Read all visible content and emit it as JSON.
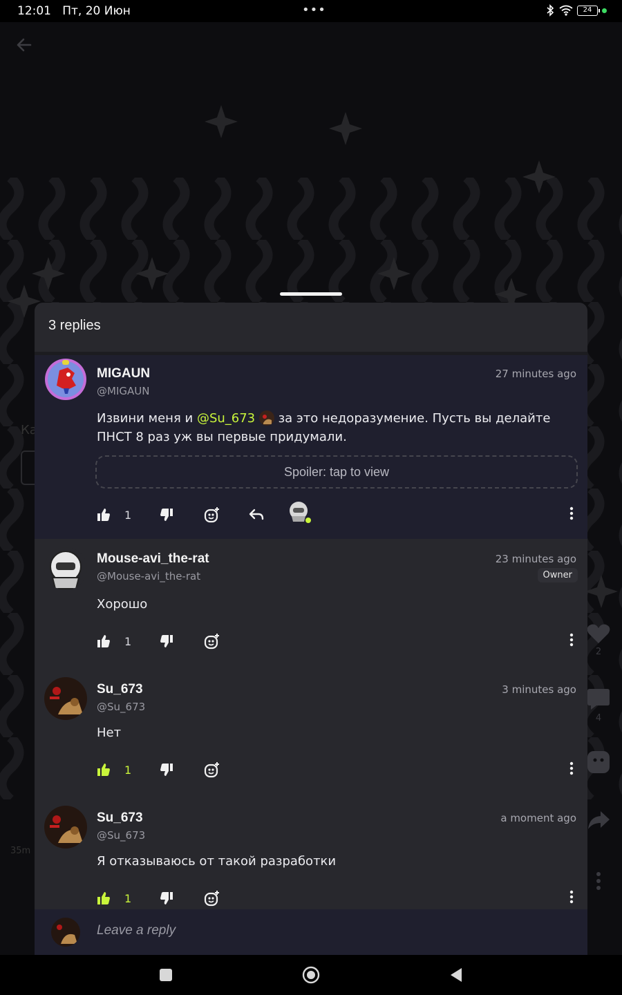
{
  "status_bar": {
    "time": "12:01",
    "date": "Пт, 20 Июн",
    "more": "•••",
    "battery": "24",
    "icons": [
      "bluetooth-icon",
      "wifi-icon",
      "battery-icon",
      "status-dot"
    ]
  },
  "background": {
    "left_text": "Ка",
    "left_time": "35m",
    "side_actions": [
      {
        "icon": "heart-icon",
        "count": "2"
      },
      {
        "icon": "comment-icon",
        "count": "4"
      },
      {
        "icon": "sticker-icon",
        "count": ""
      },
      {
        "icon": "share-icon",
        "count": ""
      },
      {
        "icon": "more-icon",
        "count": ""
      }
    ]
  },
  "sheet": {
    "title": "3 replies"
  },
  "comments": [
    {
      "name": "MIGAUN",
      "handle": "@MIGAUN",
      "time": "27 minutes ago",
      "text_before": "Извини меня и ",
      "mention": "@Su_673",
      "text_after": " за это недоразумение. Пусть вы делайте ПНСТ 8 раз уж вы первые придумали.",
      "spoiler": "Spoiler: tap to view",
      "likes": "1",
      "liked": false
    },
    {
      "name": "Mouse-avi_the-rat",
      "handle": "@Mouse-avi_the-rat",
      "time": "23 minutes ago",
      "badge": "Owner",
      "text": "Хорошо",
      "likes": "1",
      "liked": false
    },
    {
      "name": "Su_673",
      "handle": "@Su_673",
      "time": "3 minutes ago",
      "text": "Нет",
      "likes": "1",
      "liked": true
    },
    {
      "name": "Su_673",
      "handle": "@Su_673",
      "time": "a moment ago",
      "text": "Я отказываюсь от такой разработки",
      "likes": "1",
      "liked": true
    }
  ],
  "reply_bar": {
    "placeholder": "Leave a reply"
  },
  "colors": {
    "accent": "#c9f53b",
    "sheet_bg": "#28282d",
    "highlight_bg": "#1f1f2e",
    "page_bg": "#000000"
  }
}
